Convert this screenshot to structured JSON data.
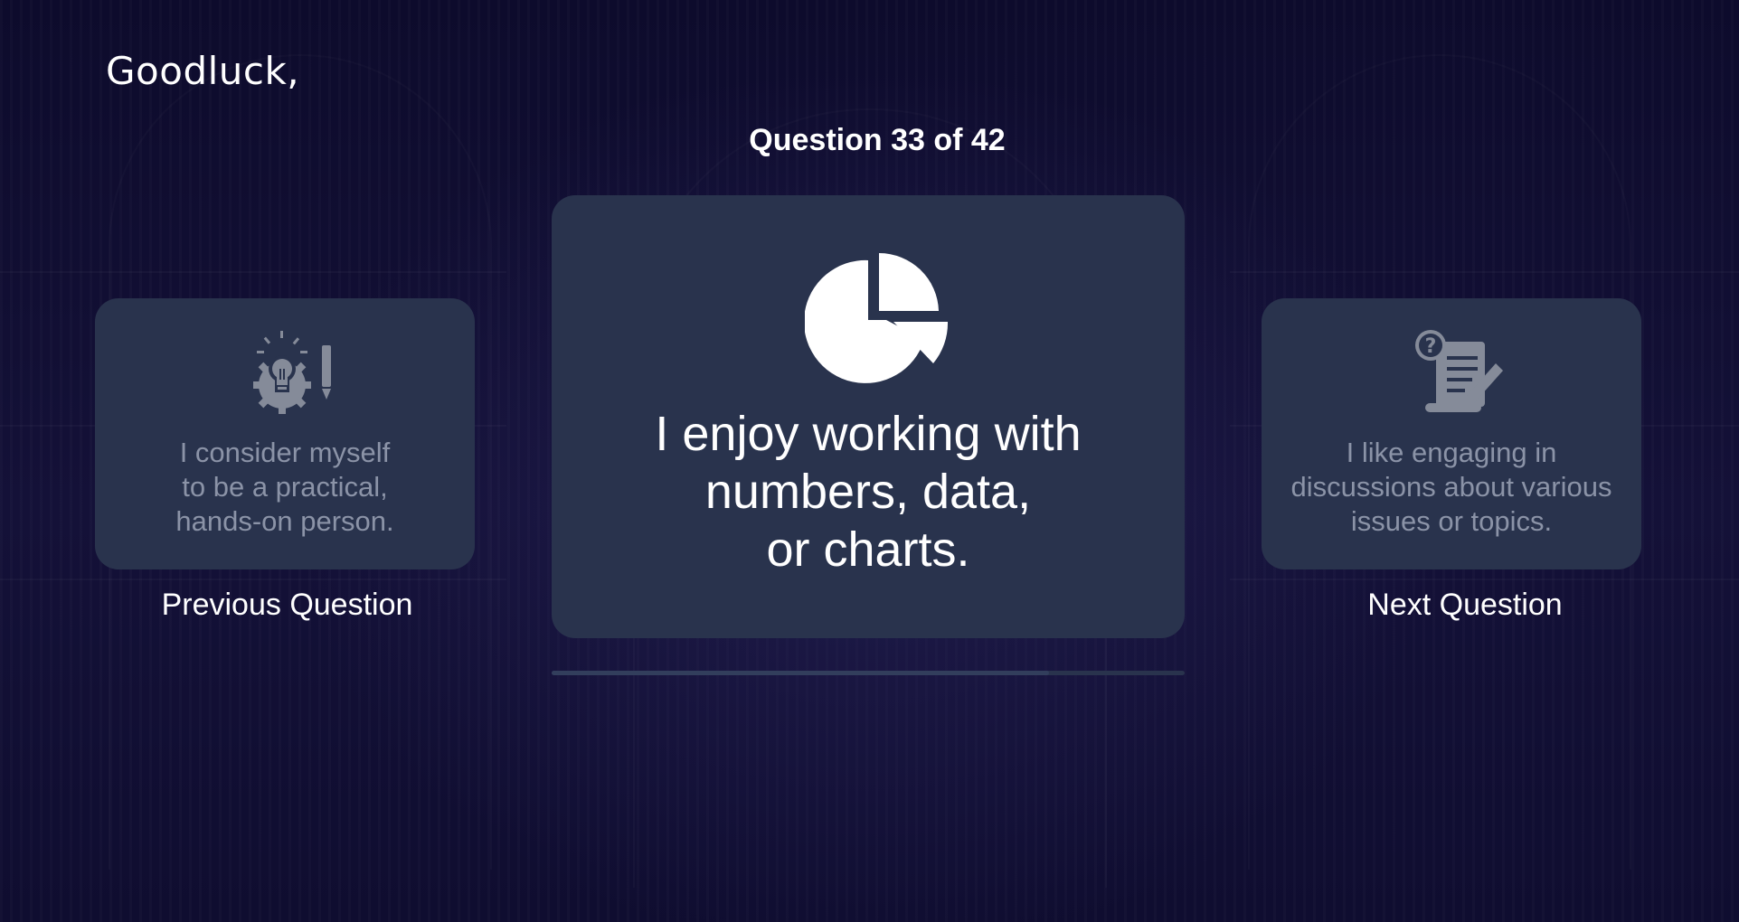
{
  "greeting": "Goodluck,",
  "question_counter": "Question 33 of 42",
  "progress": {
    "current": 33,
    "total": 42
  },
  "current_card": {
    "icon": "pie-chart-icon",
    "lines": [
      "I enjoy working with",
      "numbers, data,",
      "or charts."
    ]
  },
  "previous_card": {
    "icon": "lightbulb-gear-pencil-icon",
    "lines": [
      "I consider myself",
      "to be a practical,",
      "hands-on person."
    ],
    "nav_label": "Previous Question"
  },
  "next_card": {
    "icon": "document-question-pen-icon",
    "lines": [
      "I like engaging in",
      "discussions about various",
      "issues or topics."
    ],
    "nav_label": "Next Question"
  },
  "colors": {
    "background": "#0f0d2f",
    "card": "#29334d",
    "text": "#ffffff",
    "muted_text": "#8b93a7",
    "muted_icon": "#858b99"
  }
}
